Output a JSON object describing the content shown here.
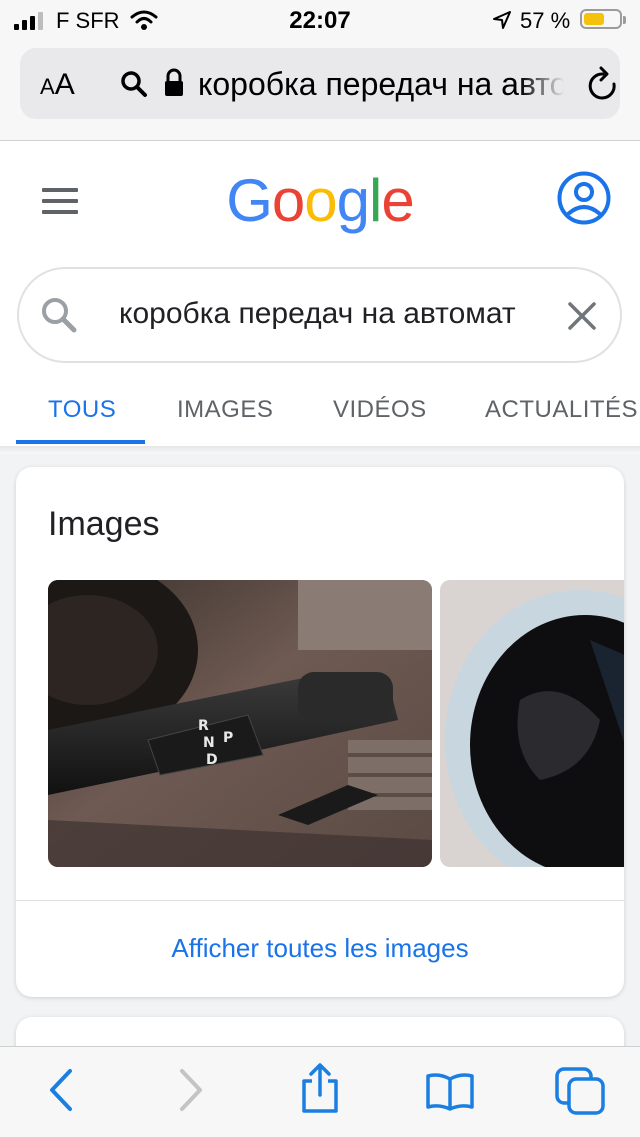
{
  "status_bar": {
    "carrier": "F SFR",
    "time": "22:07",
    "battery_percent": "57 %",
    "battery_level": 0.57
  },
  "browser": {
    "text_size_label": "AA",
    "url_text": "коробка передач на авто"
  },
  "google": {
    "logo_letters": [
      "G",
      "o",
      "o",
      "g",
      "l",
      "e"
    ],
    "search_query": "коробка передач на автомат",
    "tabs": [
      {
        "label": "TOUS",
        "active": true
      },
      {
        "label": "IMAGES",
        "active": false
      },
      {
        "label": "VIDÉOS",
        "active": false
      },
      {
        "label": "ACTUALITÉS",
        "active": false
      }
    ]
  },
  "images_card": {
    "title": "Images",
    "gear_letters": [
      "R",
      "N",
      "P",
      "D"
    ],
    "show_all_link": "Afficher toutes les images"
  },
  "toolbar": {
    "icons": [
      "back-icon",
      "forward-icon",
      "share-icon",
      "bookmarks-icon",
      "tabs-icon"
    ]
  },
  "colors": {
    "google_blue": "#4285f4",
    "google_red": "#ea4335",
    "google_yellow": "#fbbc05",
    "google_green": "#34a853",
    "link_blue": "#1a73e8",
    "ios_blue": "#1a7fe0"
  }
}
